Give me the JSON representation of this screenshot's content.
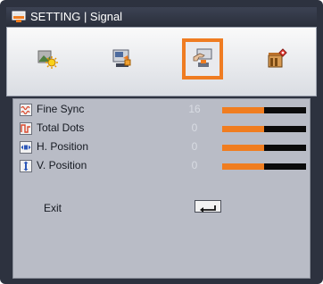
{
  "title": {
    "text": "SETTING | Signal",
    "icon": "settings-screen-icon"
  },
  "tabs": [
    {
      "name": "image-settings-tab",
      "icon": "image-sun-icon",
      "selected": false
    },
    {
      "name": "display-settings-tab",
      "icon": "display-screen-icon",
      "selected": false
    },
    {
      "name": "setting-tab",
      "icon": "hand-setting-icon",
      "selected": true
    },
    {
      "name": "options-tab",
      "icon": "options-tools-icon",
      "selected": false
    }
  ],
  "accent_color": "#f07d20",
  "items": [
    {
      "label": "Fine Sync",
      "value": "16",
      "level": 0.5,
      "icon": "fine-sync-icon"
    },
    {
      "label": "Total Dots",
      "value": "0",
      "level": 0.5,
      "icon": "total-dots-icon"
    },
    {
      "label": "H. Position",
      "value": "0",
      "level": 0.5,
      "icon": "h-position-icon"
    },
    {
      "label": "V. Position",
      "value": "0",
      "level": 0.5,
      "icon": "v-position-icon"
    }
  ],
  "exit": {
    "label": "Exit",
    "icon": "enter-key-icon"
  }
}
